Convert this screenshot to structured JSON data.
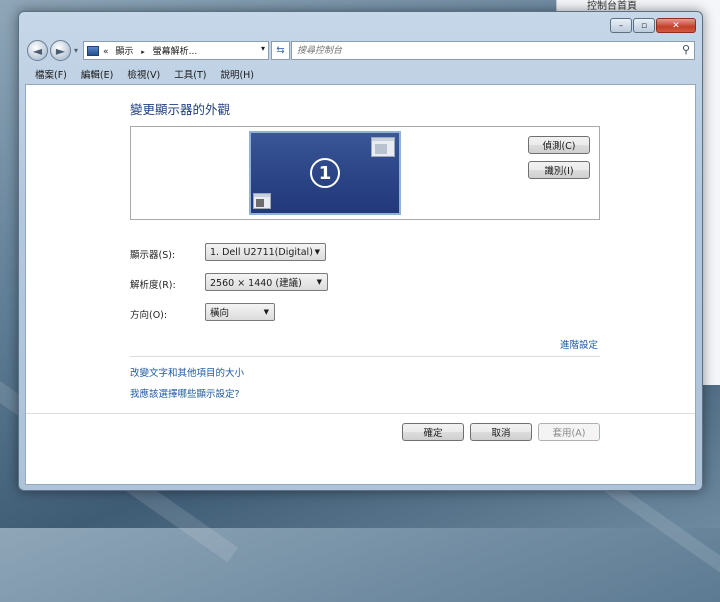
{
  "background_panel": {
    "title": "控制台首頁"
  },
  "window": {
    "caption": {
      "minimize": "–",
      "maximize": "▫",
      "close": "✕"
    }
  },
  "navbar": {
    "address": {
      "prefix": "«",
      "crumb1": "顯示",
      "separator": "▸",
      "crumb2": "螢幕解析..."
    },
    "search_placeholder": "搜尋控制台"
  },
  "menu": [
    "檔案(F)",
    "編輯(E)",
    "檢視(V)",
    "工具(T)",
    "說明(H)"
  ],
  "main": {
    "heading": "變更顯示器的外觀",
    "monitor_number": "1",
    "detect_button": "偵測(C)",
    "identify_button": "識別(I)",
    "display_label": "顯示器(S):",
    "display_value": "1. Dell U2711(Digital)",
    "resolution_label": "解析度(R):",
    "resolution_value": "2560 × 1440 (建議)",
    "orientation_label": "方向(O):",
    "orientation_value": "橫向",
    "advanced_link": "進階設定",
    "text_size_link": "改變文字和其他項目的大小",
    "which_settings_link": "我應該選擇哪些顯示設定?"
  },
  "footer": {
    "ok": "確定",
    "cancel": "取消",
    "apply": "套用(A)"
  },
  "colors": {
    "link": "#1c5aa8",
    "heading": "#1f3f7f",
    "monitor": "#2d4789"
  }
}
